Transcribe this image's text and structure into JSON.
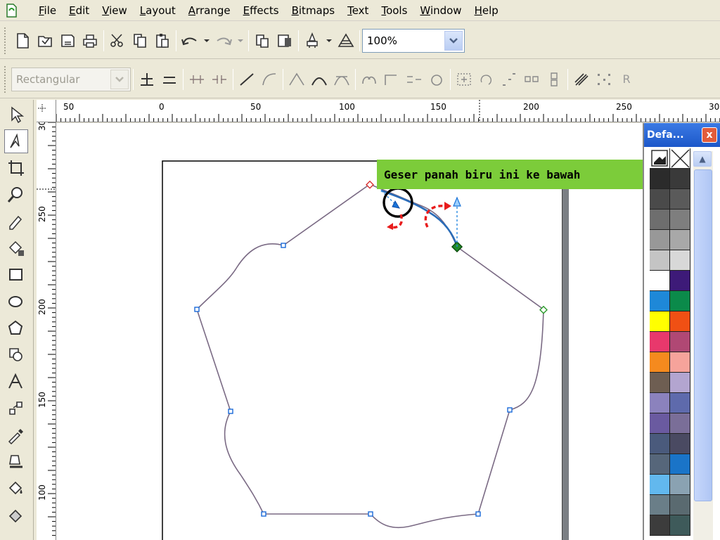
{
  "menubar": {
    "items": [
      "File",
      "Edit",
      "View",
      "Layout",
      "Arrange",
      "Effects",
      "Bitmaps",
      "Text",
      "Tools",
      "Window",
      "Help"
    ]
  },
  "toolbar": {
    "zoom_value": "100%"
  },
  "property_bar": {
    "node_type_value": "Rectangular",
    "cut_label": "R"
  },
  "ruler": {
    "h_ticks": [
      "50",
      "0",
      "50",
      "100",
      "150",
      "200",
      "250",
      "30"
    ],
    "v_ticks": [
      "30",
      "250",
      "200",
      "150",
      "100"
    ]
  },
  "palette": {
    "title": "Defa...",
    "close_glyph": "x",
    "swatches": [
      "#2b2b2b",
      "#3a3a3a",
      "#4a4a4a",
      "#5a5a5a",
      "#6e6e6e",
      "#7e7e7e",
      "#989898",
      "#a8a8a8",
      "#c4c4c4",
      "#d8d8d8",
      "#ffffff",
      "#3d1a78",
      "#1e88d8",
      "#0b8a4a",
      "#ffff00",
      "#f05014",
      "#e8386c",
      "#b04874",
      "#f58a1e",
      "#f6a39b",
      "#6e5e52",
      "#b3a5d0",
      "#8b82bd",
      "#5e6aac",
      "#6a5aa0",
      "#7a6e98",
      "#4a5a7c",
      "#4a4a62",
      "#56667a",
      "#1a74c8",
      "#62b8ee",
      "#8aa2b2",
      "#6a7e88",
      "#5a6a70",
      "#3c3c3c",
      "#3e5a5a"
    ]
  },
  "canvas": {
    "instruction": "Geser panah biru ini ke bawah",
    "highlight_color": "#000000",
    "arrow_color": "#e81c1c",
    "handle_color": "#1e7ae0",
    "banner_color": "#7ccc3a"
  }
}
